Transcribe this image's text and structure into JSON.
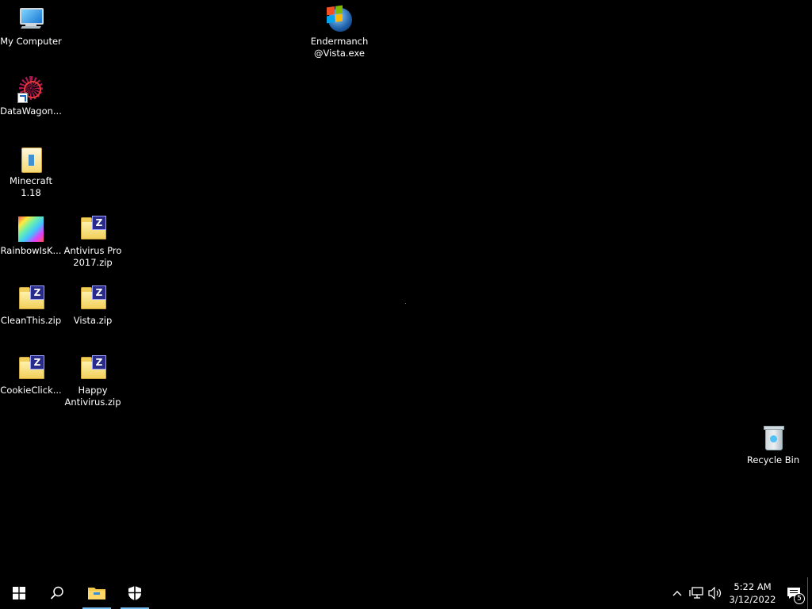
{
  "desktop": {
    "icons": [
      {
        "label": "My Computer"
      },
      {
        "label": "Endermanch\n@Vista.exe"
      },
      {
        "label": "DataWagon..."
      },
      {
        "label": "Minecraft\n1.18"
      },
      {
        "label": "RainbowIsK..."
      },
      {
        "label": "Antivirus Pro\n2017.zip"
      },
      {
        "label": "CleanThis.zip"
      },
      {
        "label": "Vista.zip"
      },
      {
        "label": "CookieClick..."
      },
      {
        "label": "Happy\nAntivirus.zip"
      },
      {
        "label": "Recycle Bin"
      }
    ],
    "zip_badge": "Z"
  },
  "taskbar": {
    "start_icon": "windows-logo-icon",
    "search_icon": "search-icon",
    "pinned": [
      {
        "name": "file-explorer",
        "icon": "folder-icon",
        "active": true
      },
      {
        "name": "windows-security",
        "icon": "shield-icon",
        "active": true
      }
    ],
    "tray": {
      "time": "5:22 AM",
      "date": "3/12/2022",
      "notification_count": "5"
    }
  },
  "colors": {
    "background": "#000000",
    "taskbar": "#000000",
    "active_indicator": "#76b9ed"
  }
}
